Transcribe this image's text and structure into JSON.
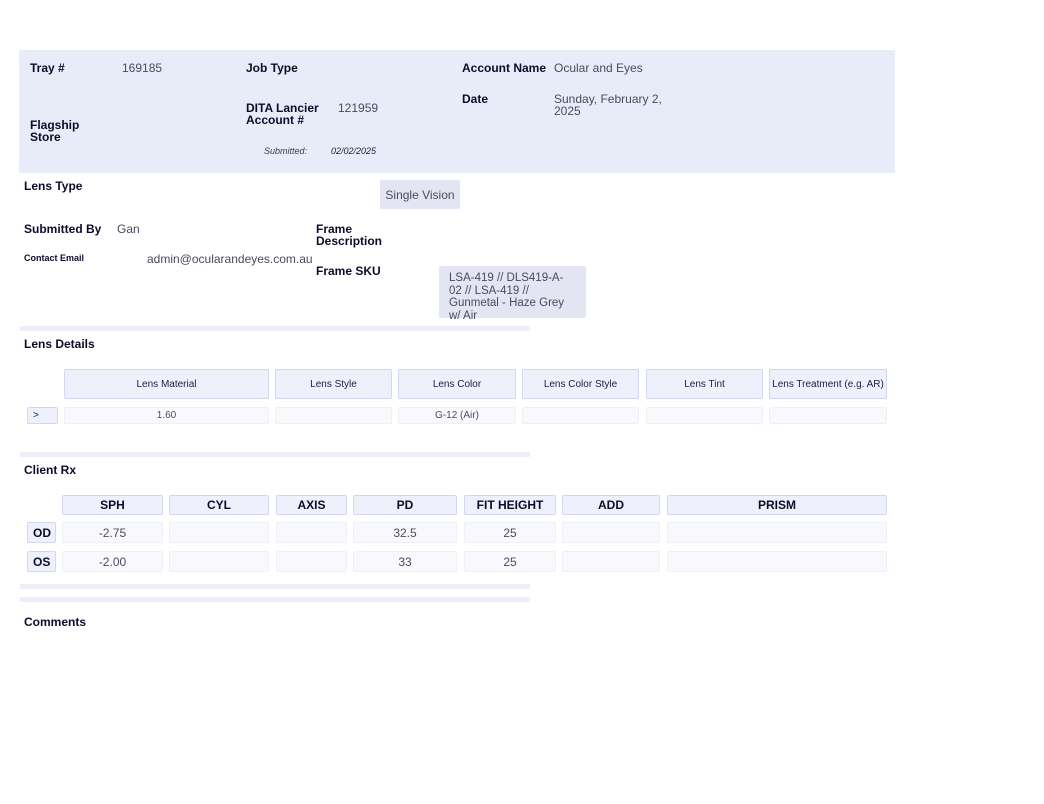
{
  "header": {
    "tray_label": "Tray #",
    "tray_value": "169185",
    "job_type_label": "Job Type",
    "account_name_label": "Account Name",
    "account_name_value": "Ocular and Eyes",
    "dita_label": "DITA Lancier Account #",
    "dita_value": "121959",
    "date_label": "Date",
    "date_value": "Sunday, February 2, 2025",
    "flagship_label": "Flagship Store",
    "submitted_label": "Submitted:",
    "submitted_value": "02/02/2025"
  },
  "lens_type": {
    "label": "Lens Type",
    "value": "Single Vision"
  },
  "submitter": {
    "submitted_by_label": "Submitted By",
    "submitted_by_value": "Gan",
    "contact_email_label": "Contact Email",
    "contact_email_value": "admin@ocularandeyes.com.au",
    "frame_description_label": "Frame Description",
    "frame_sku_label": "Frame SKU",
    "frame_sku_value": "LSA-419 // DLS419-A-02 // LSA-419 // Gunmetal - Haze Grey w/ Air"
  },
  "lens_details": {
    "title": "Lens Details",
    "columns": [
      "Lens Material",
      "Lens Style",
      "Lens Color",
      "Lens Color Style",
      "Lens Tint",
      "Lens Treatment (e.g. AR)"
    ],
    "row_toggle": ">",
    "row": [
      "1.60",
      "",
      "G-12 (Air)",
      "",
      "",
      ""
    ]
  },
  "client_rx": {
    "title": "Client Rx",
    "columns": [
      "SPH",
      "CYL",
      "AXIS",
      "PD",
      "FIT HEIGHT",
      "ADD",
      "PRISM"
    ],
    "rows": [
      {
        "eye": "OD",
        "values": [
          "-2.75",
          "",
          "",
          "32.5",
          "25",
          "",
          ""
        ]
      },
      {
        "eye": "OS",
        "values": [
          "-2.00",
          "",
          "",
          "33",
          "25",
          "",
          ""
        ]
      }
    ]
  },
  "comments": {
    "title": "Comments"
  }
}
